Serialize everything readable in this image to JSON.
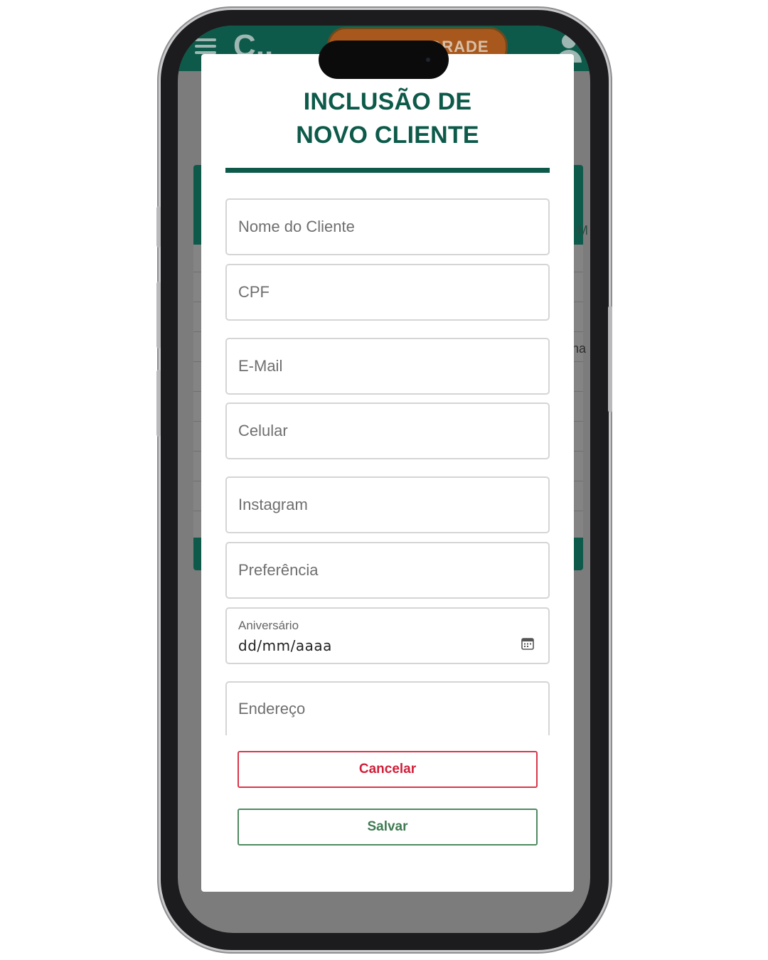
{
  "background_app": {
    "logo_text": "C..",
    "upgrade_label": "FAZER UPGRADE",
    "partial_text_1": "-M",
    "partial_text_2": "na"
  },
  "modal": {
    "title": "INCLUSÃO DE NOVO CLIENTE",
    "fields": {
      "nome": {
        "placeholder": "Nome do Cliente"
      },
      "cpf": {
        "placeholder": "CPF"
      },
      "email": {
        "placeholder": "E-Mail"
      },
      "celular": {
        "placeholder": "Celular"
      },
      "instagram": {
        "placeholder": "Instagram"
      },
      "preferencia": {
        "placeholder": "Preferência"
      },
      "aniversario": {
        "label": "Aniversário",
        "value": "dd/mm/aaaa"
      },
      "endereco": {
        "placeholder": "Endereço"
      }
    },
    "buttons": {
      "cancel_label": "Cancelar",
      "save_label": "Salvar"
    }
  },
  "colors": {
    "brand": "#0d5a4a",
    "cancel": "#d0203a",
    "save": "#3f7a52"
  },
  "icons": {
    "menu": "hamburger-icon",
    "user": "user-icon",
    "calendar": "calendar-icon"
  }
}
